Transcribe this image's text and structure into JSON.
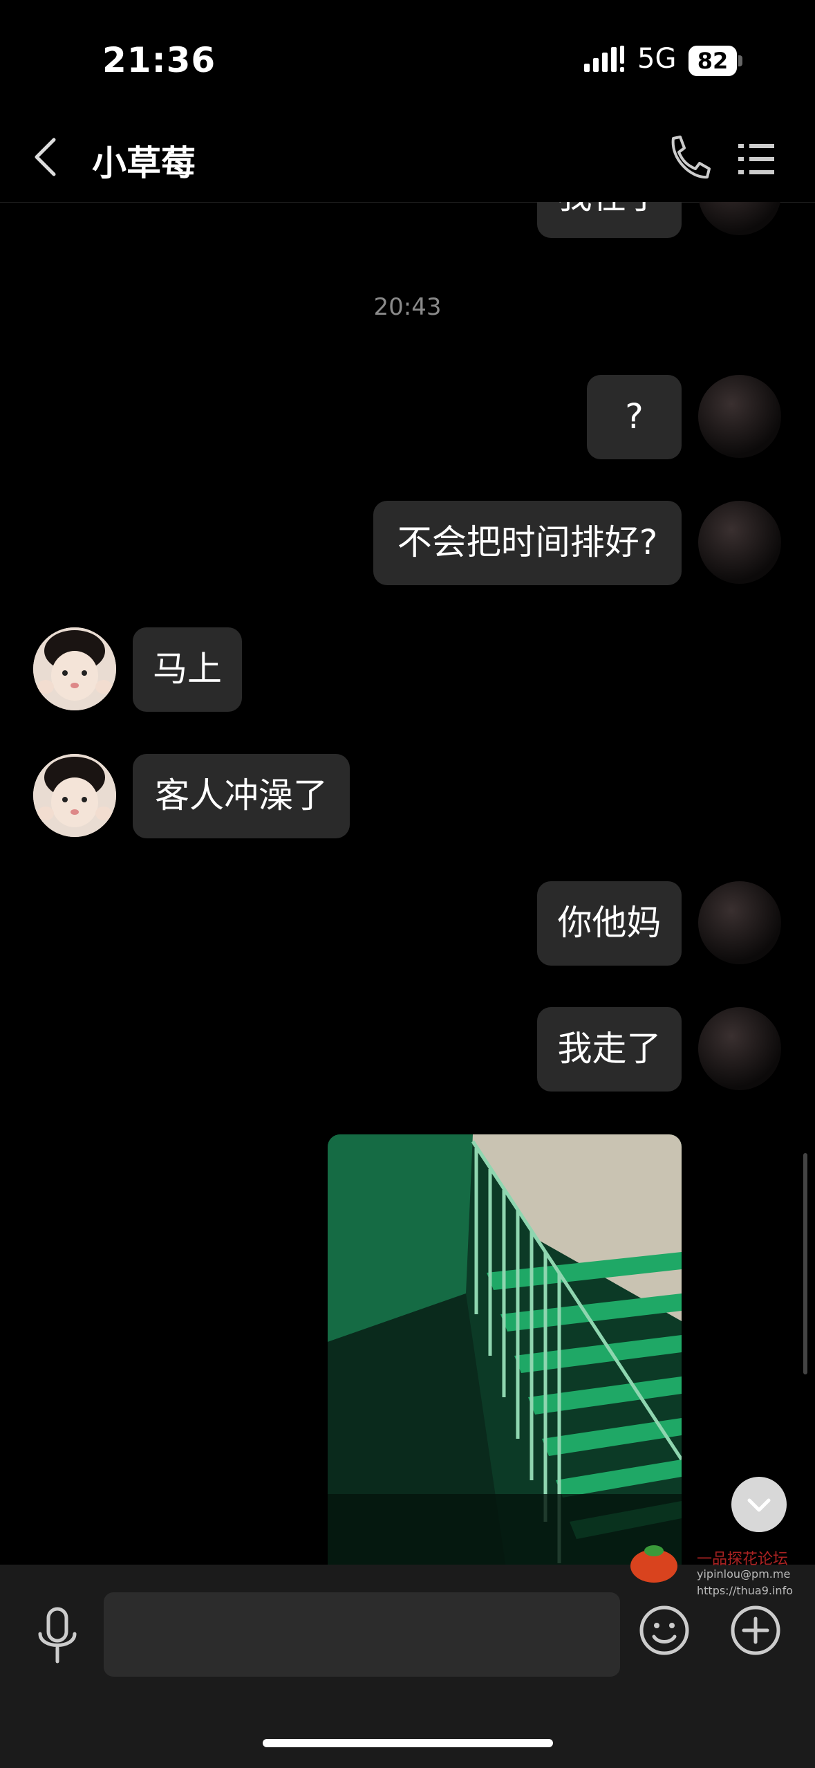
{
  "status_bar": {
    "time": "21:36",
    "network": "5G",
    "battery": "82"
  },
  "nav": {
    "title": "小草莓",
    "icons": [
      "back-arrow-icon",
      "phone-icon",
      "menu-icon"
    ]
  },
  "chat": {
    "messages": [
      {
        "side": "right",
        "text": "我在了",
        "partially_visible": true
      },
      {
        "type": "timestamp",
        "text": "20:43"
      },
      {
        "side": "right",
        "text": "?"
      },
      {
        "side": "right",
        "text": "不会把时间排好?"
      },
      {
        "side": "left",
        "text": "马上"
      },
      {
        "side": "left",
        "text": "客人冲澡了"
      },
      {
        "side": "right",
        "text": "你他妈"
      },
      {
        "side": "right",
        "text": "我走了"
      },
      {
        "side": "right",
        "type": "image",
        "icon": "stairwell-photo"
      }
    ]
  },
  "input": {
    "placeholder": ""
  },
  "watermark": {
    "line1": "一品探花论坛",
    "line2": "yipinlou@pm.me",
    "line3": "https://thua9.info"
  }
}
